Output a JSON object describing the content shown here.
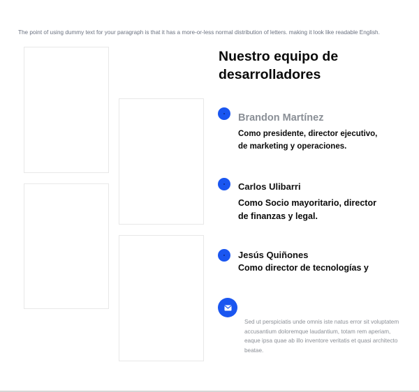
{
  "intro_text": "The point of using dummy text for your paragraph is that it has a more-or-less normal distribution of letters. making it look like readable English.",
  "section": {
    "title_line1": "Nuestro equipo de",
    "title_line2": "desarrolladores"
  },
  "members": [
    {
      "name": "Brandon Martínez",
      "role_line1": "Como presidente, director ejecutivo,",
      "role_line2": "de marketing y operaciones."
    },
    {
      "name": "Carlos Ulibarri",
      "role_line1": "Como Socio mayoritario, director",
      "role_line2": "de finanzas y legal."
    },
    {
      "name": "Jesús Quiñones",
      "role_line1": "Como director de tecnologías y",
      "role_line2": ""
    }
  ],
  "contact": {
    "icon": "envelope-icon",
    "text": "Sed ut perspiciatis unde omnis iste natus error sit voluptatem accusantium doloremque laudantium, totam rem aperiam, eaque ipsa quae ab illo inventore veritatis et quasi architecto beatae."
  },
  "colors": {
    "accent": "#1a56f0",
    "muted_text": "#8b8f96",
    "heading": "#0a0a0a"
  }
}
